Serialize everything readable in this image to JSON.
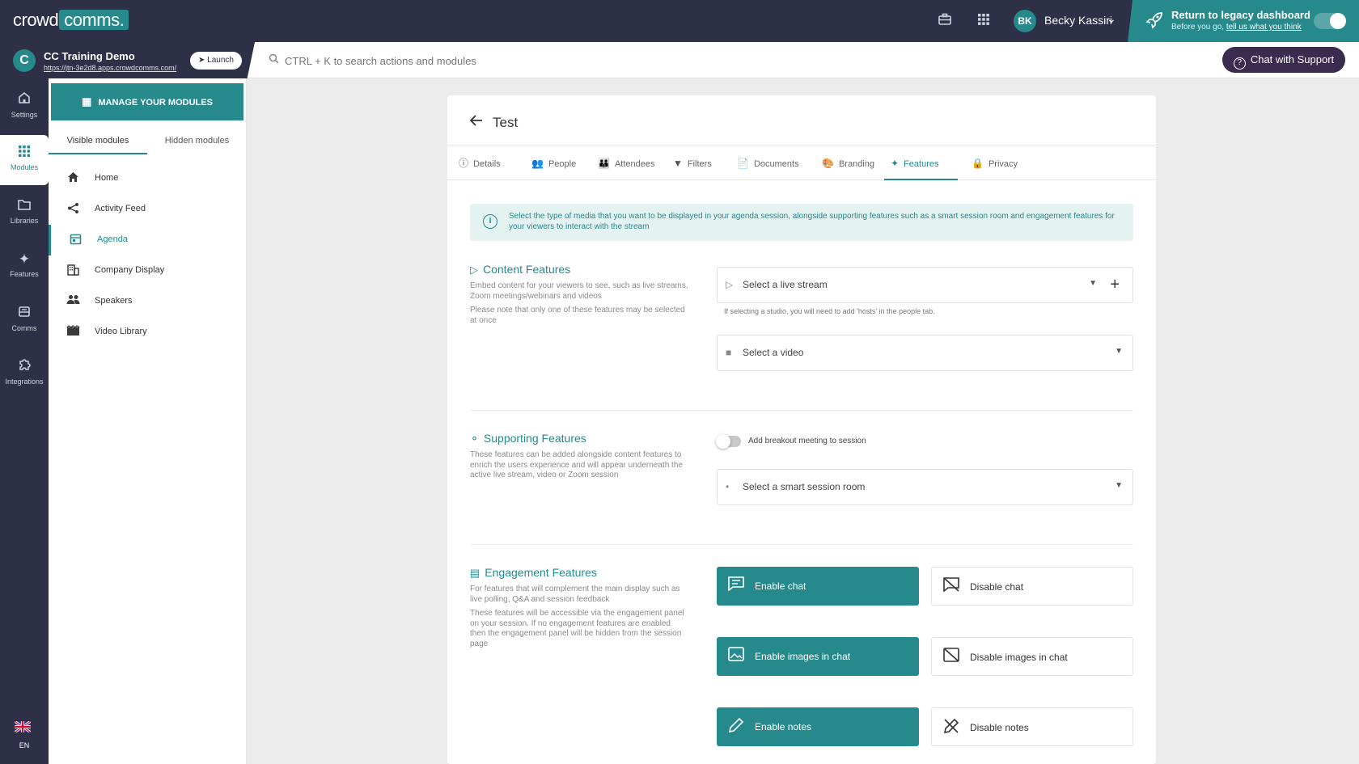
{
  "topbar": {
    "logo_main": "crowd",
    "logo_accent": "comms.",
    "user_initials": "BK",
    "user_name": "Becky Kassiri",
    "legacy_title": "Return to legacy dashboard",
    "legacy_sub_prefix": "Before you go,",
    "legacy_sub_link": "tell us what you think"
  },
  "event": {
    "logo_letter": "C",
    "name": "CC Training Demo",
    "url": "https://jtn-3e2d8.apps.crowdcomms.com/",
    "launch_label": "Launch"
  },
  "search": {
    "placeholder": "CTRL + K to search actions and modules"
  },
  "support": {
    "label": "Chat with Support"
  },
  "rail": {
    "items": [
      {
        "label": "Settings",
        "icon": "home-icon"
      },
      {
        "label": "Modules",
        "icon": "grid-icon"
      },
      {
        "label": "Libraries",
        "icon": "folder-icon"
      },
      {
        "label": "Features",
        "icon": "sparkle-icon"
      },
      {
        "label": "Comms",
        "icon": "inbox-icon"
      },
      {
        "label": "Integrations",
        "icon": "puzzle-icon"
      }
    ],
    "lang": "EN"
  },
  "modules": {
    "manage_label": "MANAGE YOUR MODULES",
    "tab_visible": "Visible modules",
    "tab_hidden": "Hidden modules",
    "items": [
      {
        "label": "Home",
        "icon": "home-icon"
      },
      {
        "label": "Activity Feed",
        "icon": "share-icon"
      },
      {
        "label": "Agenda",
        "icon": "calendar-icon"
      },
      {
        "label": "Company Display",
        "icon": "building-icon"
      },
      {
        "label": "Speakers",
        "icon": "people-icon"
      },
      {
        "label": "Video Library",
        "icon": "film-icon"
      }
    ]
  },
  "page": {
    "title": "Test",
    "tabs": [
      "Details",
      "People",
      "Attendees",
      "Filters",
      "Documents",
      "Branding",
      "Features",
      "Privacy"
    ],
    "active_tab": "Features",
    "info": "Select the type of media that you want to be displayed in your agenda session, alongside supporting features such as a smart session room and engagement features for your viewers to interact with the stream"
  },
  "content_features": {
    "title": "Content Features",
    "desc1": "Embed content for your viewers to see, such as live streams, Zoom meetings/webinars and videos",
    "desc2": "Please note that only one of these features may be selected at once",
    "livestream_placeholder": "Select a live stream",
    "studio_hint": "If selecting a studio, you will need to add 'hosts' in the people tab.",
    "video_placeholder": "Select a video"
  },
  "supporting_features": {
    "title": "Supporting Features",
    "desc": "These features can be added alongside content features to enrich the users experience and will appear underneath the active live stream, video or Zoom session",
    "breakout_label": "Add breakout meeting to session",
    "room_placeholder": "Select a smart session room"
  },
  "engagement_features": {
    "title": "Engagement Features",
    "desc1": "For features that will complement the main display such as live polling, Q&A and session feedback",
    "desc2": "These features will be accessible via the engagement panel on your session. If no engagement features are enabled then the engagement panel will be hidden from the session page",
    "enable_chat": "Enable chat",
    "disable_chat": "Disable chat",
    "enable_images": "Enable images in chat",
    "disable_images": "Disable images in chat",
    "enable_notes": "Enable notes",
    "disable_notes": "Disable notes"
  },
  "colors": {
    "teal": "#26898c",
    "navy": "#2e3047",
    "support": "#3b2b4f"
  }
}
